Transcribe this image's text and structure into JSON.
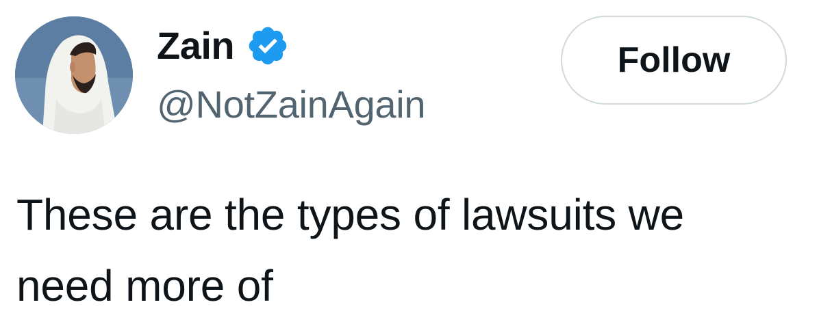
{
  "author": {
    "display_name": "Zain",
    "handle": "@NotZainAgain",
    "verified": true,
    "verified_icon": "verified-badge-icon",
    "avatar_icon": "profile-avatar"
  },
  "actions": {
    "follow_label": "Follow"
  },
  "tweet": {
    "text": "These are the types of lawsuits we\nneed more of"
  },
  "colors": {
    "text_primary": "#0f1419",
    "text_secondary": "#536471",
    "verified_blue": "#1d9bf0",
    "button_border": "#cfd9de"
  }
}
